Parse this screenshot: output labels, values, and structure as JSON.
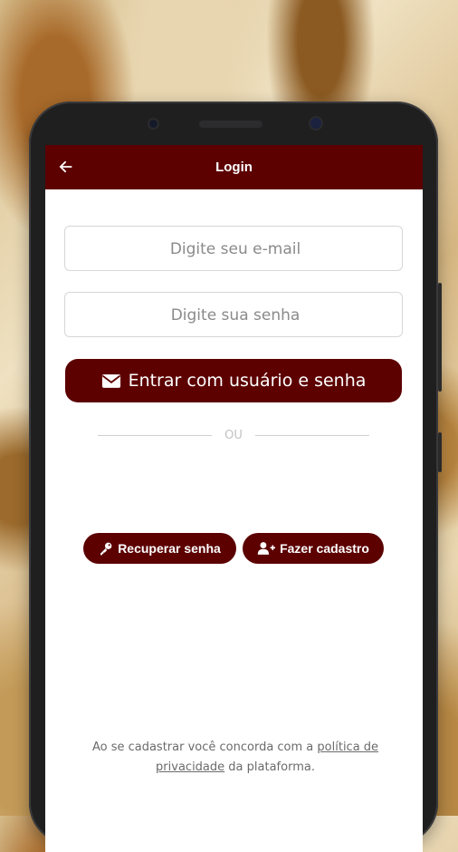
{
  "app_bar": {
    "title": "Login",
    "back_icon": "arrow-left-icon"
  },
  "login_form": {
    "email_placeholder": "Digite seu e-mail",
    "email_value": "",
    "password_placeholder": "Digite sua senha",
    "password_value": "",
    "submit_label": "Entrar com usuário e senha",
    "submit_icon": "envelope-icon"
  },
  "divider_text": "OU",
  "secondary_actions": {
    "recover_label": "Recuperar senha",
    "recover_icon": "key-icon",
    "signup_label": "Fazer cadastro",
    "signup_icon": "user-plus-icon"
  },
  "terms": {
    "prefix": "Ao se cadastrar você concorda com a",
    "link_text": "política de privacidade",
    "suffix": "da plataforma."
  },
  "colors": {
    "brand": "#5c0000",
    "background_text": "#6b6b6b"
  }
}
